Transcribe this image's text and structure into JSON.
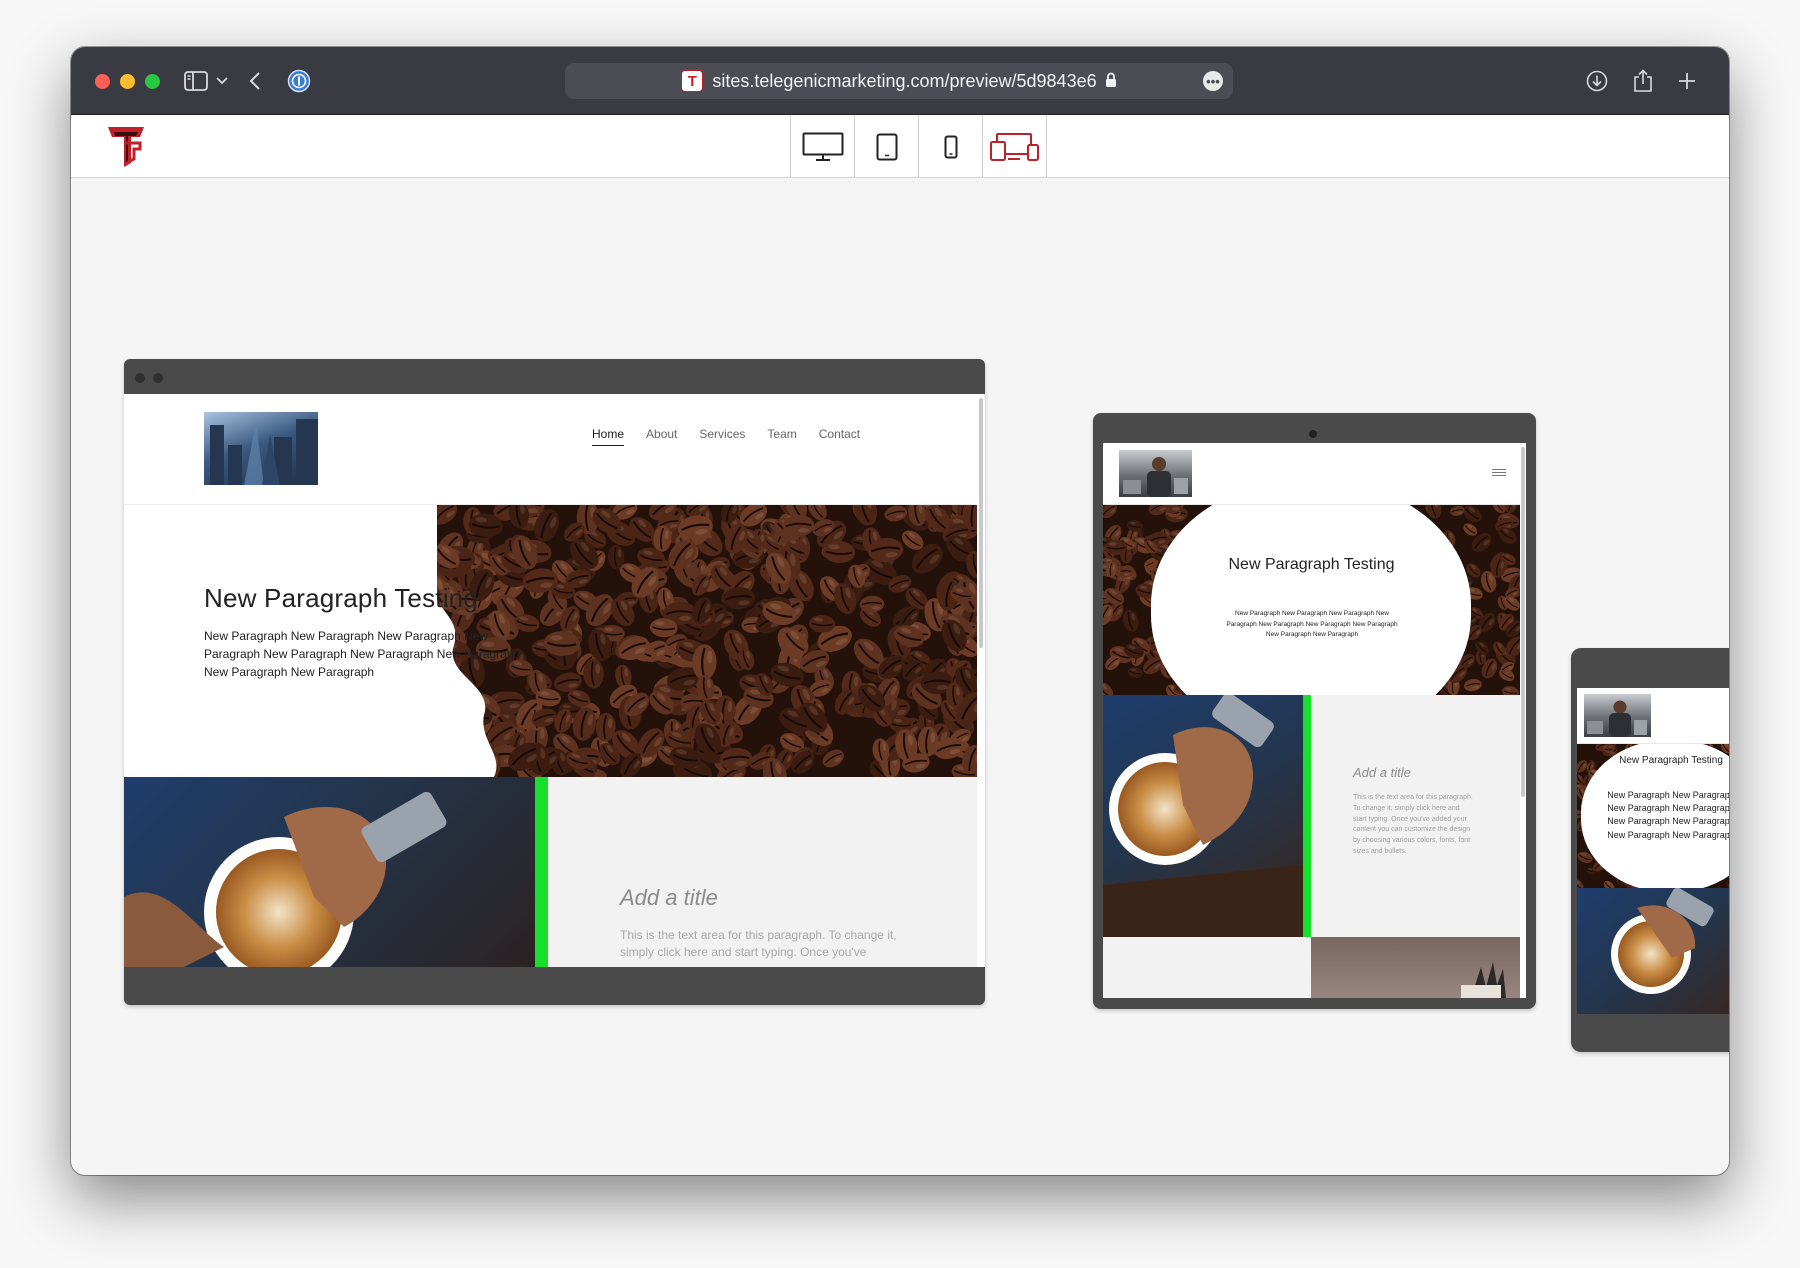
{
  "browser": {
    "url": "sites.telegenicmarketing.com/preview/5d9843e6",
    "favicon_letter": "T"
  },
  "toolbar": {
    "devices": [
      {
        "name": "desktop",
        "active": false
      },
      {
        "name": "tablet",
        "active": false
      },
      {
        "name": "mobile",
        "active": false
      },
      {
        "name": "all-devices",
        "active": true
      }
    ],
    "accent_color": "#c0202a"
  },
  "site": {
    "nav": [
      "Home",
      "About",
      "Services",
      "Team",
      "Contact"
    ],
    "active_nav": "Home",
    "hero_title": "New Paragraph Testing",
    "hero_text": "New Paragraph New Paragraph New Paragraph New Paragraph New Paragraph New Paragraph New Paragraph New Paragraph New Paragraph",
    "section_title": "Add a title",
    "section_text_desktop": "This is the text area for this paragraph. To change it, simply click here and start typing. Once you've",
    "section_text_tablet": "This is the text area for this paragraph. To change it, simply click here and start typing. Once you've added your content you can customize the design by choosing various colors, fonts, font sizes and bullets.",
    "tablet_hero_title": "New Paragraph Testing",
    "tablet_hero_text": "New Paragraph New Paragraph New Paragraph New Paragraph New Paragraph New Paragraph New Paragraph New Paragraph New Paragraph",
    "phone_hero_title": "New Paragraph Testing",
    "phone_hero_text": "New Paragraph New Paragraph New Paragraph New Paragraph New Paragraph New Paragraph New Paragraph New Paragraph",
    "accent_green": "#16e02a"
  }
}
